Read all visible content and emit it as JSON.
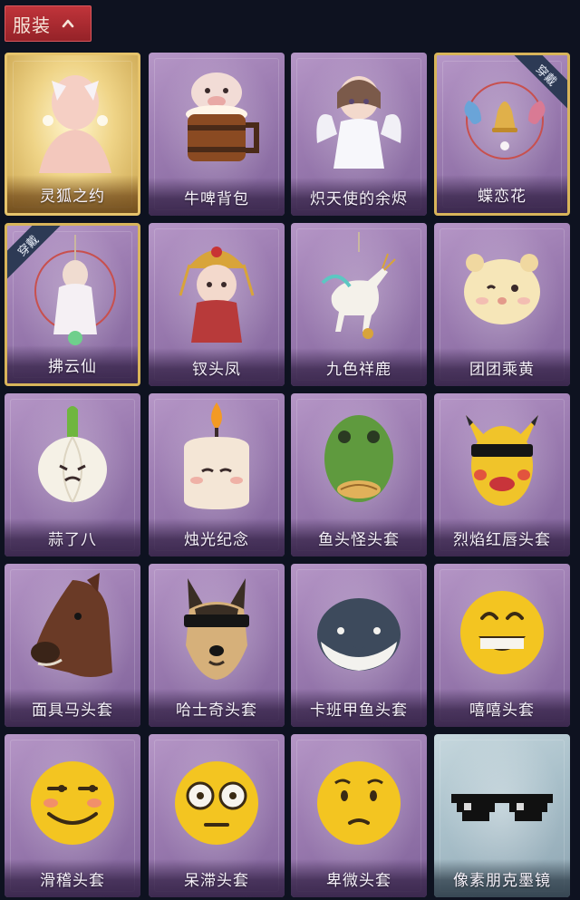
{
  "header": {
    "tab_label": "服装"
  },
  "badge_text": "穿戴",
  "items": [
    {
      "label": "灵狐之约",
      "style": "goldfull",
      "icon": "fox-spirit-avatar-icon",
      "badge": ""
    },
    {
      "label": "牛啤背包",
      "style": "purple",
      "icon": "cow-beer-barrel-icon",
      "badge": ""
    },
    {
      "label": "炽天使的余烬",
      "style": "purple",
      "icon": "angel-doll-icon",
      "badge": ""
    },
    {
      "label": "蝶恋花",
      "style": "gold",
      "icon": "butterfly-bell-icon",
      "badge": "tr"
    },
    {
      "label": "拂云仙",
      "style": "gold",
      "icon": "cloud-fairy-pendant-icon",
      "badge": "tl"
    },
    {
      "label": "钗头凤",
      "style": "purple",
      "icon": "phoenix-crown-doll-icon",
      "badge": ""
    },
    {
      "label": "九色祥鹿",
      "style": "purple",
      "icon": "deer-pendant-icon",
      "badge": ""
    },
    {
      "label": "团团乘黄",
      "style": "purple",
      "icon": "round-beast-plush-icon",
      "badge": ""
    },
    {
      "label": "蒜了八",
      "style": "purple",
      "icon": "garlic-mascot-icon",
      "badge": ""
    },
    {
      "label": "烛光纪念",
      "style": "purple",
      "icon": "candle-mascot-icon",
      "badge": ""
    },
    {
      "label": "鱼头怪头套",
      "style": "purple",
      "icon": "fish-mask-icon",
      "badge": ""
    },
    {
      "label": "烈焰红唇头套",
      "style": "purple",
      "icon": "yellow-mouse-mask-icon",
      "badge": ""
    },
    {
      "label": "面具马头套",
      "style": "purple",
      "icon": "horse-mask-icon",
      "badge": ""
    },
    {
      "label": "哈士奇头套",
      "style": "purple",
      "icon": "husky-mask-icon",
      "badge": ""
    },
    {
      "label": "卡班甲鱼头套",
      "style": "purple",
      "icon": "whale-mask-icon",
      "badge": ""
    },
    {
      "label": "嘻嘻头套",
      "style": "purple",
      "icon": "grin-emoji-mask-icon",
      "badge": ""
    },
    {
      "label": "滑稽头套",
      "style": "purple",
      "icon": "smirk-emoji-mask-icon",
      "badge": ""
    },
    {
      "label": "呆滞头套",
      "style": "purple",
      "icon": "stare-emoji-mask-icon",
      "badge": ""
    },
    {
      "label": "卑微头套",
      "style": "purple",
      "icon": "shy-emoji-mask-icon",
      "badge": ""
    },
    {
      "label": "像素朋克墨镜",
      "style": "blue",
      "icon": "pixel-sunglasses-icon",
      "badge": ""
    }
  ]
}
